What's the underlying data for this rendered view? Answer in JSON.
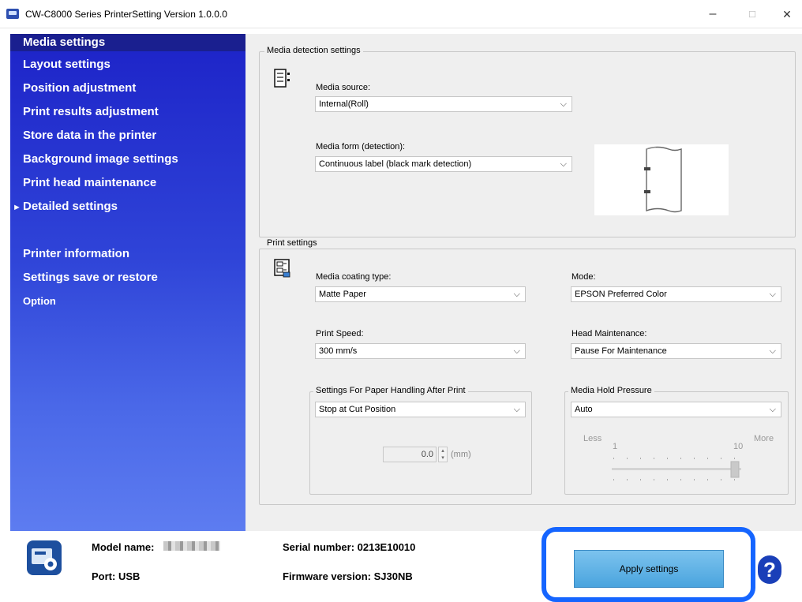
{
  "window": {
    "title": "CW-C8000 Series PrinterSetting Version 1.0.0.0",
    "minimize": "–",
    "maximize": "□",
    "close": "✕"
  },
  "sidebar": {
    "items": [
      {
        "label": "Media settings"
      },
      {
        "label": "Layout settings"
      },
      {
        "label": "Position adjustment"
      },
      {
        "label": "Print results adjustment"
      },
      {
        "label": "Store data in the printer"
      },
      {
        "label": "Background image settings"
      },
      {
        "label": "Print head maintenance"
      },
      {
        "label": "Detailed settings"
      },
      {
        "label": "Printer information"
      },
      {
        "label": "Settings save or restore"
      },
      {
        "label": "Option"
      }
    ],
    "expand_glyph": "►"
  },
  "media_detection": {
    "legend": "Media detection settings",
    "source_label": "Media source:",
    "source_value": "Internal(Roll)",
    "form_label": "Media form (detection):",
    "form_value": "Continuous label (black mark detection)"
  },
  "print_settings": {
    "legend": "Print settings",
    "coating_label": "Media coating type:",
    "coating_value": "Matte Paper",
    "mode_label": "Mode:",
    "mode_value": "EPSON Preferred Color",
    "speed_label": "Print Speed:",
    "speed_value": "300 mm/s",
    "head_label": "Head Maintenance:",
    "head_value": "Pause For Maintenance",
    "handling_legend": "Settings For Paper Handling After Print",
    "handling_value": "Stop at Cut Position",
    "offset_value": "0.0",
    "offset_unit": "(mm)",
    "pressure_legend": "Media Hold Pressure",
    "pressure_value": "Auto",
    "slider_less": "Less",
    "slider_more": "More",
    "slider_min": "1",
    "slider_max": "10",
    "slider_level": 10
  },
  "status": {
    "model_label": "Model name:",
    "port_label": "Port: USB",
    "serial_label": "Serial number: 0213E10010",
    "firmware_label": "Firmware version: SJ30NB"
  },
  "apply_label": "Apply settings",
  "help_glyph": "?"
}
